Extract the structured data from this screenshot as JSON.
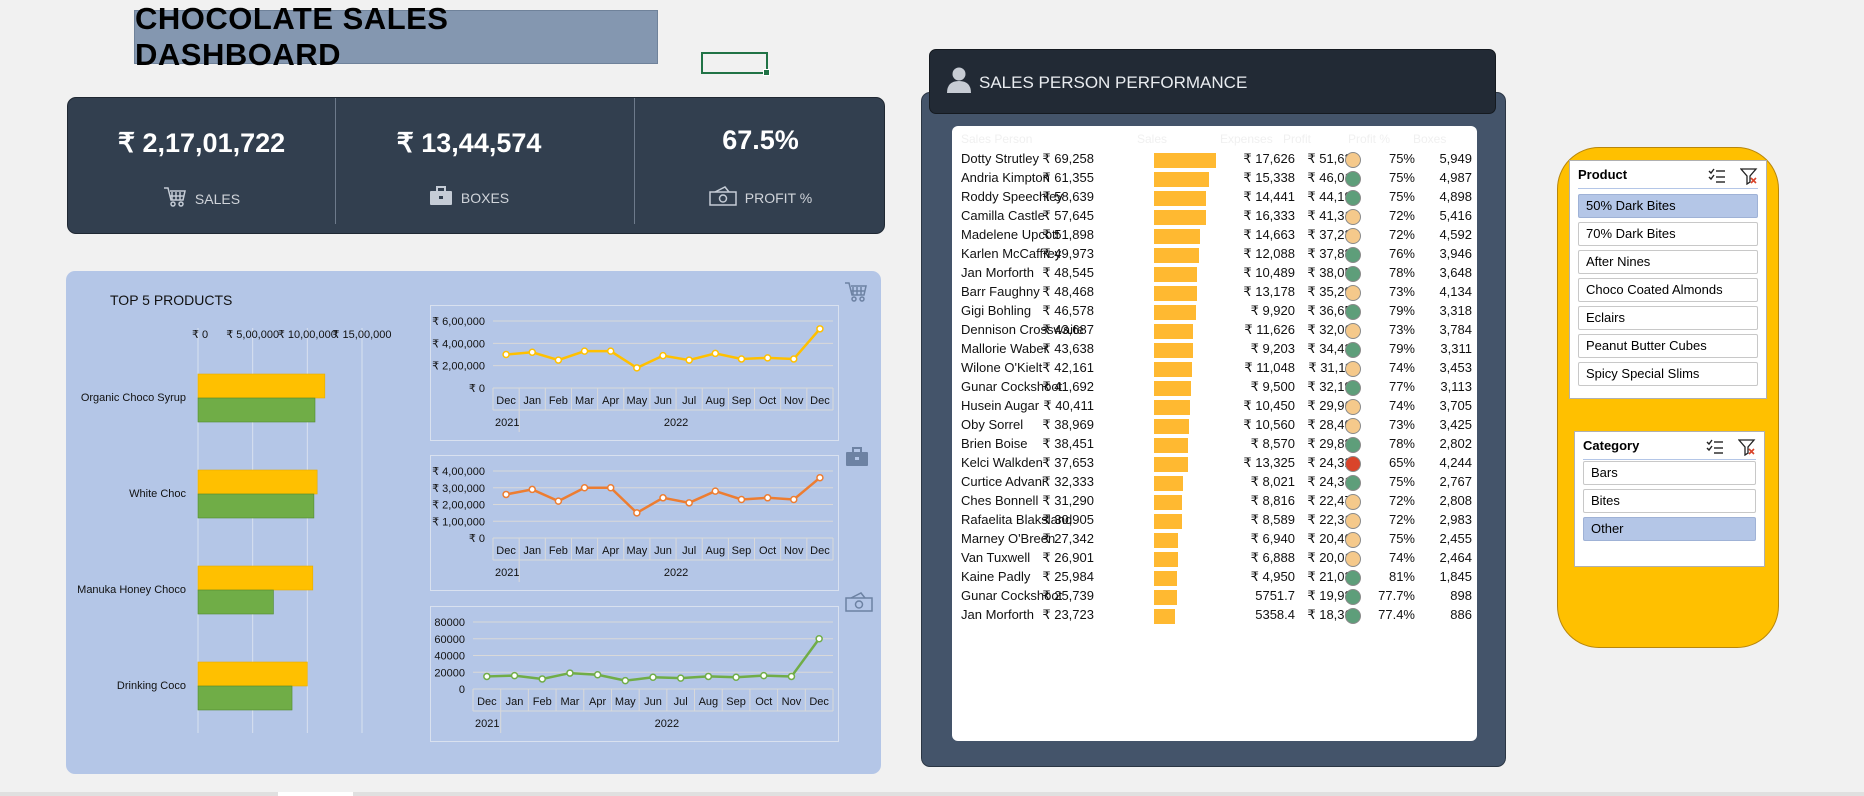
{
  "dashboard": {
    "title": "CHOCOLATE SALES DASHBOARD"
  },
  "kpis": [
    {
      "value": "₹ 2,17,01,722",
      "label": "SALES",
      "icon": "cart-icon"
    },
    {
      "value": "₹ 13,44,574",
      "label": "BOXES",
      "icon": "briefcase-icon"
    },
    {
      "value": "67.5%",
      "label": "PROFIT %",
      "icon": "cash-icon"
    }
  ],
  "top_products": {
    "title": "TOP 5 PRODUCTS"
  },
  "chart_data": [
    {
      "type": "bar",
      "orientation": "horizontal",
      "title": "TOP 5 PRODUCTS",
      "categories": [
        "Organic Choco Syrup",
        "White Choc",
        "Manuka Honey Choco",
        "Drinking Coco"
      ],
      "series": [
        {
          "color": "#ffc000",
          "values": [
            1160000,
            1090000,
            1050000,
            1000000
          ]
        },
        {
          "color": "#70ad47",
          "values": [
            1070000,
            1060000,
            690000,
            860000
          ]
        }
      ],
      "xaxis_ticks": [
        "₹ 0",
        "₹ 5,00,000",
        "₹ 10,00,000",
        "₹ 15,00,000"
      ],
      "xlim": [
        0,
        1500000
      ],
      "grid": true
    },
    {
      "type": "line",
      "color": "#ffc000",
      "x": [
        "Dec",
        "Jan",
        "Feb",
        "Mar",
        "Apr",
        "May",
        "Jun",
        "Jul",
        "Aug",
        "Sep",
        "Oct",
        "Nov",
        "Dec"
      ],
      "year_labels": [
        "2021",
        "2022"
      ],
      "values": [
        300000,
        320000,
        250000,
        330000,
        330000,
        180000,
        290000,
        250000,
        310000,
        260000,
        270000,
        260000,
        530000
      ],
      "yaxis_ticks": [
        "₹ 0",
        "₹ 2,00,000",
        "₹ 4,00,000",
        "₹ 6,00,000"
      ],
      "ylim": [
        0,
        600000
      ]
    },
    {
      "type": "line",
      "color": "#ed7d31",
      "x": [
        "Dec",
        "Jan",
        "Feb",
        "Mar",
        "Apr",
        "May",
        "Jun",
        "Jul",
        "Aug",
        "Sep",
        "Oct",
        "Nov",
        "Dec"
      ],
      "year_labels": [
        "2021",
        "2022"
      ],
      "values": [
        260000,
        290000,
        220000,
        300000,
        300000,
        150000,
        240000,
        210000,
        280000,
        230000,
        240000,
        230000,
        360000
      ],
      "yaxis_ticks": [
        "₹ 0",
        "₹ 1,00,000",
        "₹ 2,00,000",
        "₹ 3,00,000",
        "₹ 4,00,000"
      ],
      "ylim": [
        0,
        400000
      ]
    },
    {
      "type": "line",
      "color": "#70ad47",
      "x": [
        "Dec",
        "Jan",
        "Feb",
        "Mar",
        "Apr",
        "May",
        "Jun",
        "Jul",
        "Aug",
        "Sep",
        "Oct",
        "Nov",
        "Dec"
      ],
      "year_labels": [
        "2021",
        "2022"
      ],
      "values": [
        15000,
        16000,
        12000,
        19000,
        17000,
        10000,
        14000,
        13000,
        15000,
        14000,
        16000,
        15000,
        60000
      ],
      "yaxis_ticks": [
        "0",
        "20000",
        "40000",
        "60000",
        "80000"
      ],
      "ylim": [
        0,
        80000
      ]
    }
  ],
  "performance": {
    "title": "SALES PERSON PERFORMANCE",
    "columns": [
      "Sales Person",
      "Sales",
      "Expenses",
      "Profit",
      "Profit %",
      "Boxes"
    ],
    "max_sales": 69258,
    "rows": [
      {
        "name": "Dotty Strutley",
        "sales": "₹ 69,258",
        "sales_value": 69258,
        "expenses": "₹ 17,626",
        "profit": "₹ 51,632",
        "status": "amber",
        "pct": "75%",
        "boxes": "5,949"
      },
      {
        "name": "Andria Kimpton",
        "sales": "₹ 61,355",
        "sales_value": 61355,
        "expenses": "₹ 15,338",
        "profit": "₹ 46,017",
        "status": "green",
        "pct": "75%",
        "boxes": "4,987"
      },
      {
        "name": "Roddy Speechley",
        "sales": "₹ 58,639",
        "sales_value": 58639,
        "expenses": "₹ 14,441",
        "profit": "₹ 44,198",
        "status": "green",
        "pct": "75%",
        "boxes": "4,898"
      },
      {
        "name": "Camilla Castle",
        "sales": "₹ 57,645",
        "sales_value": 57645,
        "expenses": "₹ 16,333",
        "profit": "₹ 41,312",
        "status": "amber",
        "pct": "72%",
        "boxes": "5,416"
      },
      {
        "name": "Madelene Upcott",
        "sales": "₹ 51,898",
        "sales_value": 51898,
        "expenses": "₹ 14,663",
        "profit": "₹ 37,235",
        "status": "amber",
        "pct": "72%",
        "boxes": "4,592"
      },
      {
        "name": "Karlen McCaffrey",
        "sales": "₹ 49,973",
        "sales_value": 49973,
        "expenses": "₹ 12,088",
        "profit": "₹ 37,885",
        "status": "green",
        "pct": "76%",
        "boxes": "3,946"
      },
      {
        "name": "Jan Morforth",
        "sales": "₹ 48,545",
        "sales_value": 48545,
        "expenses": "₹ 10,489",
        "profit": "₹ 38,056",
        "status": "green",
        "pct": "78%",
        "boxes": "3,648"
      },
      {
        "name": "Barr Faughny",
        "sales": "₹ 48,468",
        "sales_value": 48468,
        "expenses": "₹ 13,178",
        "profit": "₹ 35,290",
        "status": "amber",
        "pct": "73%",
        "boxes": "4,134"
      },
      {
        "name": "Gigi Bohling",
        "sales": "₹ 46,578",
        "sales_value": 46578,
        "expenses": "₹ 9,920",
        "profit": "₹ 36,658",
        "status": "green",
        "pct": "79%",
        "boxes": "3,318"
      },
      {
        "name": "Dennison Crosswaite",
        "sales": "₹ 43,687",
        "sales_value": 43687,
        "expenses": "₹ 11,626",
        "profit": "₹ 32,061",
        "status": "amber",
        "pct": "73%",
        "boxes": "3,784"
      },
      {
        "name": "Mallorie Waber",
        "sales": "₹ 43,638",
        "sales_value": 43638,
        "expenses": "₹ 9,203",
        "profit": "₹ 34,435",
        "status": "green",
        "pct": "79%",
        "boxes": "3,311"
      },
      {
        "name": "Wilone O'Kielt",
        "sales": "₹ 42,161",
        "sales_value": 42161,
        "expenses": "₹ 11,048",
        "profit": "₹ 31,113",
        "status": "amber",
        "pct": "74%",
        "boxes": "3,453"
      },
      {
        "name": "Gunar Cockshoot",
        "sales": "₹ 41,692",
        "sales_value": 41692,
        "expenses": "₹ 9,500",
        "profit": "₹ 32,192",
        "status": "green",
        "pct": "77%",
        "boxes": "3,113"
      },
      {
        "name": "Husein Augar",
        "sales": "₹ 40,411",
        "sales_value": 40411,
        "expenses": "₹ 10,450",
        "profit": "₹ 29,961",
        "status": "amber",
        "pct": "74%",
        "boxes": "3,705"
      },
      {
        "name": "Oby Sorrel",
        "sales": "₹ 38,969",
        "sales_value": 38969,
        "expenses": "₹ 10,560",
        "profit": "₹ 28,409",
        "status": "amber",
        "pct": "73%",
        "boxes": "3,425"
      },
      {
        "name": "Brien Boise",
        "sales": "₹ 38,451",
        "sales_value": 38451,
        "expenses": "₹ 8,570",
        "profit": "₹ 29,882",
        "status": "green",
        "pct": "78%",
        "boxes": "2,802"
      },
      {
        "name": "Kelci Walkden",
        "sales": "₹ 37,653",
        "sales_value": 37653,
        "expenses": "₹ 13,325",
        "profit": "₹ 24,328",
        "status": "red",
        "pct": "65%",
        "boxes": "4,244"
      },
      {
        "name": "Curtice Advani",
        "sales": "₹ 32,333",
        "sales_value": 32333,
        "expenses": "₹ 8,021",
        "profit": "₹ 24,312",
        "status": "green",
        "pct": "75%",
        "boxes": "2,767"
      },
      {
        "name": "Ches Bonnell",
        "sales": "₹ 31,290",
        "sales_value": 31290,
        "expenses": "₹ 8,816",
        "profit": "₹ 22,475",
        "status": "amber",
        "pct": "72%",
        "boxes": "2,808"
      },
      {
        "name": "Rafaelita Blaksland",
        "sales": "₹ 30,905",
        "sales_value": 30905,
        "expenses": "₹ 8,589",
        "profit": "₹ 22,316",
        "status": "amber",
        "pct": "72%",
        "boxes": "2,983"
      },
      {
        "name": "Marney O'Breen",
        "sales": "₹ 27,342",
        "sales_value": 27342,
        "expenses": "₹ 6,940",
        "profit": "₹ 20,402",
        "status": "amber",
        "pct": "75%",
        "boxes": "2,455"
      },
      {
        "name": "Van Tuxwell",
        "sales": "₹ 26,901",
        "sales_value": 26901,
        "expenses": "₹ 6,888",
        "profit": "₹ 20,013",
        "status": "amber",
        "pct": "74%",
        "boxes": "2,464"
      },
      {
        "name": "Kaine Padly",
        "sales": "₹ 25,984",
        "sales_value": 25984,
        "expenses": "₹ 4,950",
        "profit": "₹ 21,034",
        "status": "green",
        "pct": "81%",
        "boxes": "1,845"
      },
      {
        "name": "Gunar Cockshoot",
        "sales": "₹ 25,739",
        "sales_value": 25739,
        "expenses": "5751.7",
        "profit": "₹ 19,987",
        "status": "green",
        "pct": "77.7%",
        "boxes": "898"
      },
      {
        "name": "Jan Morforth",
        "sales": "₹ 23,723",
        "sales_value": 23723,
        "expenses": "5358.4",
        "profit": "₹ 18,365",
        "status": "green",
        "pct": "77.4%",
        "boxes": "886"
      }
    ]
  },
  "status_colors": {
    "green": "#5e9e7a",
    "amber": "#f5c98b",
    "red": "#d9442a"
  },
  "slicers": {
    "product": {
      "title": "Product",
      "items": [
        "50% Dark Bites",
        "70% Dark Bites",
        "After Nines",
        "Choco Coated Almonds",
        "Eclairs",
        "Peanut Butter Cubes",
        "Spicy Special Slims"
      ],
      "selected": [
        "50% Dark Bites"
      ]
    },
    "category": {
      "title": "Category",
      "items": [
        "Bars",
        "Bites",
        "Other"
      ],
      "selected": [
        "Other"
      ]
    }
  },
  "icons": {
    "multi_select": "multi-select-icon",
    "clear_filter": "clear-filter-icon",
    "person": "person-icon"
  }
}
